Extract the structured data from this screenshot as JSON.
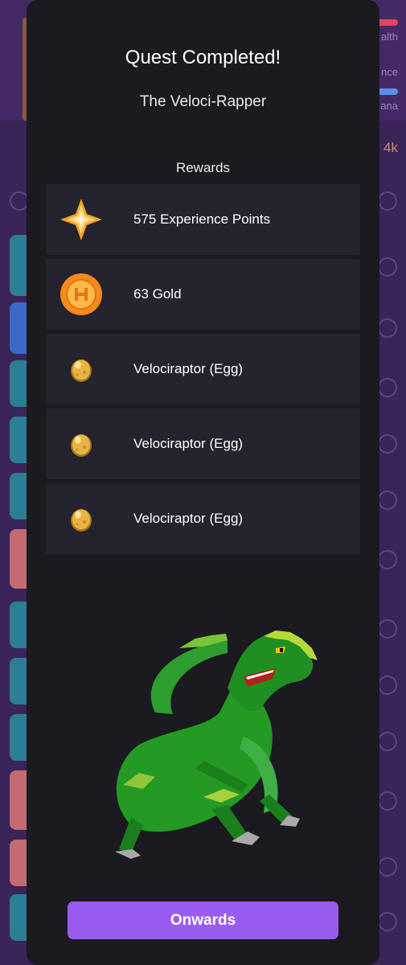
{
  "background": {
    "stats": {
      "health_label": "alth",
      "experience_label": "nce",
      "mana_label": "ana",
      "gold_value": "4k"
    }
  },
  "modal": {
    "title": "Quest Completed!",
    "quest_name": "The Veloci-Rapper",
    "rewards_heading": "Rewards",
    "rewards": [
      {
        "icon": "experience-star-icon",
        "label": "575 Experience Points"
      },
      {
        "icon": "gold-coin-icon",
        "label": "63 Gold"
      },
      {
        "icon": "egg-icon",
        "label": "Velociraptor (Egg)"
      },
      {
        "icon": "egg-icon",
        "label": "Velociraptor (Egg)"
      },
      {
        "icon": "egg-icon",
        "label": "Velociraptor (Egg)"
      }
    ],
    "image": "velociraptor-pet-illustration",
    "button_label": "Onwards"
  },
  "colors": {
    "modal_bg": "#1b1a20",
    "row_bg": "#25232d",
    "accent": "#9a5cf0",
    "app_bg": "#3a2458"
  }
}
